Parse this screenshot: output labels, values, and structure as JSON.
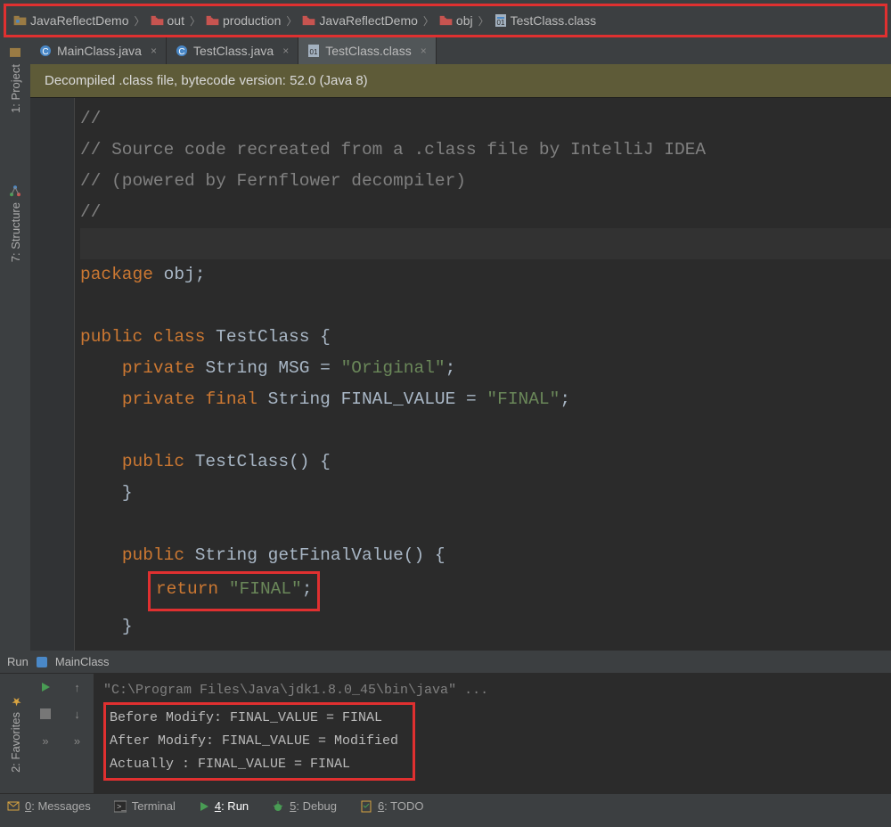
{
  "breadcrumbs": [
    {
      "icon": "module",
      "label": "JavaReflectDemo"
    },
    {
      "icon": "folder",
      "label": "out"
    },
    {
      "icon": "folder",
      "label": "production"
    },
    {
      "icon": "folder",
      "label": "JavaReflectDemo"
    },
    {
      "icon": "folder",
      "label": "obj"
    },
    {
      "icon": "classfile",
      "label": "TestClass.class"
    }
  ],
  "left_rail": {
    "project": "1: Project",
    "structure": "7: Structure"
  },
  "tabs": [
    {
      "icon": "java",
      "label": "MainClass.java",
      "active": false
    },
    {
      "icon": "java",
      "label": "TestClass.java",
      "active": false
    },
    {
      "icon": "classfile",
      "label": "TestClass.class",
      "active": true
    }
  ],
  "banner": "Decompiled .class file, bytecode version: 52.0 (Java 8)",
  "code": {
    "c1": "//",
    "c2": "// Source code recreated from a .class file by IntelliJ IDEA",
    "c3": "// (powered by Fernflower decompiler)",
    "c4": "//",
    "pkg_kw": "package ",
    "pkg_name": "obj",
    "semi": ";",
    "pub": "public ",
    "cls_kw": "class ",
    "cls_name": "TestClass",
    " ob": " {",
    "prv": "private ",
    "str_t": "String ",
    "msg": "MSG",
    " eq": " = ",
    "s_orig": "\"Original\"",
    "final": "final ",
    "fv": "FINAL_VALUE",
    "s_fin": "\"FINAL\"",
    "ctor": "TestClass",
    "paren": "() {",
    "cb": "}",
    "gfv": "getFinalValue",
    "ret": "return ",
    "ret_s": "\"FINAL\"",
    "scb": "}"
  },
  "run": {
    "title": "Run",
    "config": "MainClass",
    "cmd": "\"C:\\Program Files\\Java\\jdk1.8.0_45\\bin\\java\" ...",
    "l1": "Before Modify: FINAL_VALUE = FINAL",
    "l2": "After Modify: FINAL_VALUE = Modified",
    "l3": "Actually : FINAL_VALUE = FINAL"
  },
  "fav_label": "2: Favorites",
  "status": {
    "messages": "0: Messages",
    "terminal": "Terminal",
    "run": "4: Run",
    "debug": "5: Debug",
    "todo": "6: TODO"
  }
}
